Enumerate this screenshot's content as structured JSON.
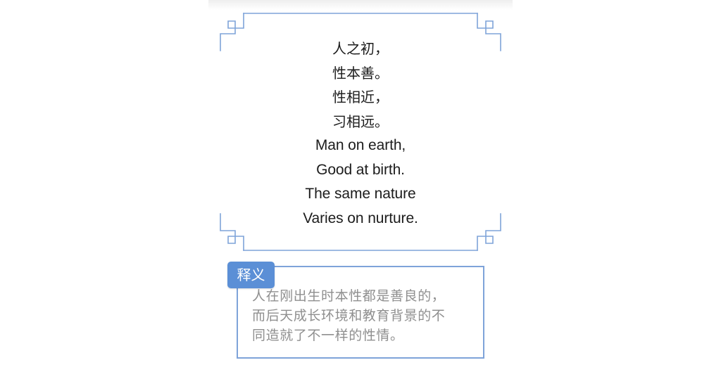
{
  "poem": {
    "lines": [
      "人之初，",
      "性本善。",
      "性相近，",
      "习相远。",
      "Man on earth,",
      "Good at birth.",
      "The same nature",
      "Varies on nurture."
    ]
  },
  "explanation": {
    "tag": "释义",
    "lines": [
      "人在刚出生时本性都是善良的，",
      "而后天成长环境和教育背景的不",
      "同造就了不一样的性情。"
    ]
  },
  "colors": {
    "frame": "#7ea3d9",
    "tag_background": "#5b8fd6",
    "poem_text": "#1c1c1c",
    "explanation_text": "#8f8f8f"
  }
}
